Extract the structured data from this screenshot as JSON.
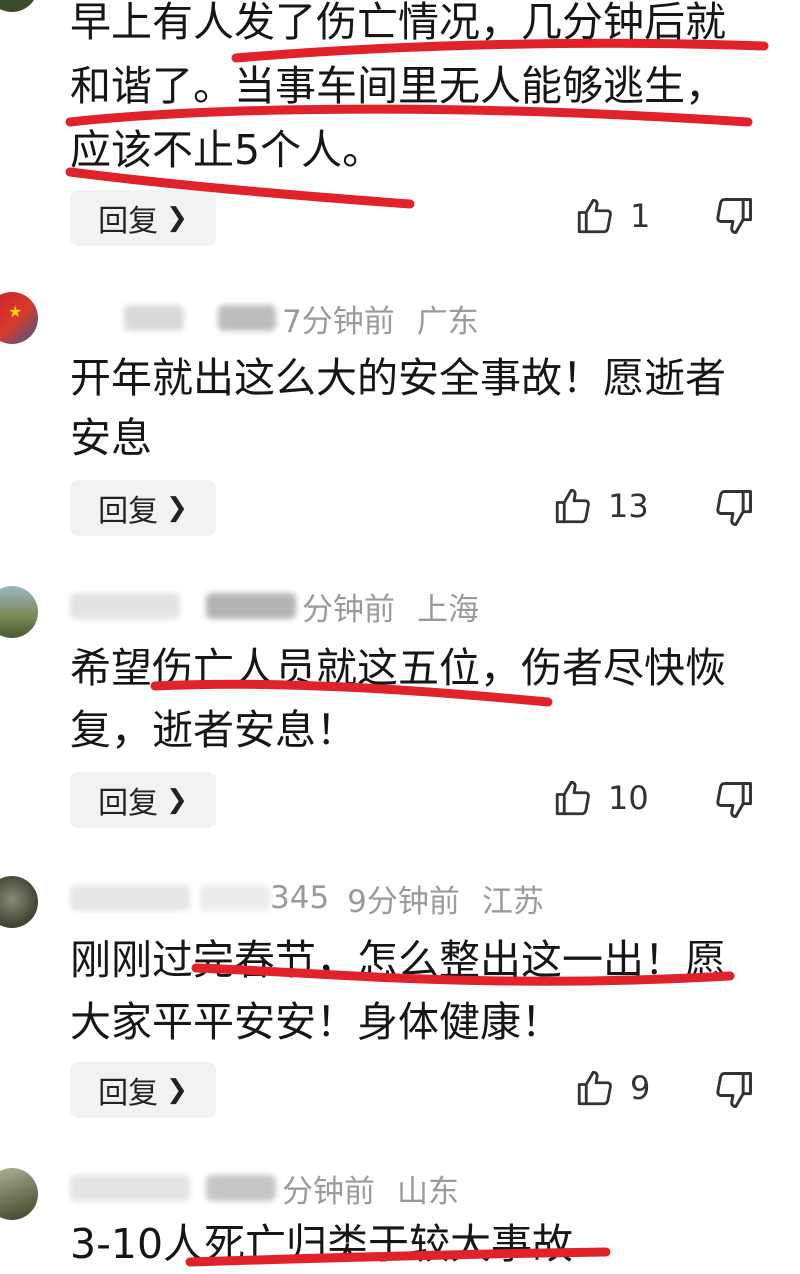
{
  "comments": [
    {
      "lines": [
        "早上有人发了伤亡情况，几分钟后就",
        "和谐了。当事车间里无人能够逃生，",
        "应该不止5个人。"
      ],
      "reply_label": "回复",
      "likes": "1"
    },
    {
      "time": "7分钟前",
      "location": "广东",
      "lines": [
        "开年就出这么大的安全事故！愿逝者",
        "安息"
      ],
      "reply_label": "回复",
      "likes": "13"
    },
    {
      "time": "分钟前",
      "location": "上海",
      "lines": [
        "希望伤亡人员就这五位，伤者尽快恢",
        "复，逝者安息！"
      ],
      "reply_label": "回复",
      "likes": "10"
    },
    {
      "username_visible": "345",
      "time": "9分钟前",
      "location": "江苏",
      "lines": [
        "刚刚过完春节，怎么整出这一出！愿",
        "大家平平安安！身体健康！"
      ],
      "reply_label": "回复",
      "likes": "9"
    },
    {
      "time": "分钟前",
      "location": "山东",
      "lines": [
        "3-10人死亡归类于较大事故"
      ]
    }
  ],
  "icons": {
    "like": "thumbs-up-icon",
    "dislike": "thumbs-down-icon",
    "reply_arrow": "chevron-right-icon"
  },
  "colors": {
    "underline": "#e0222c",
    "meta": "#9a9a9a",
    "reply_bg": "#f2f2f2"
  }
}
